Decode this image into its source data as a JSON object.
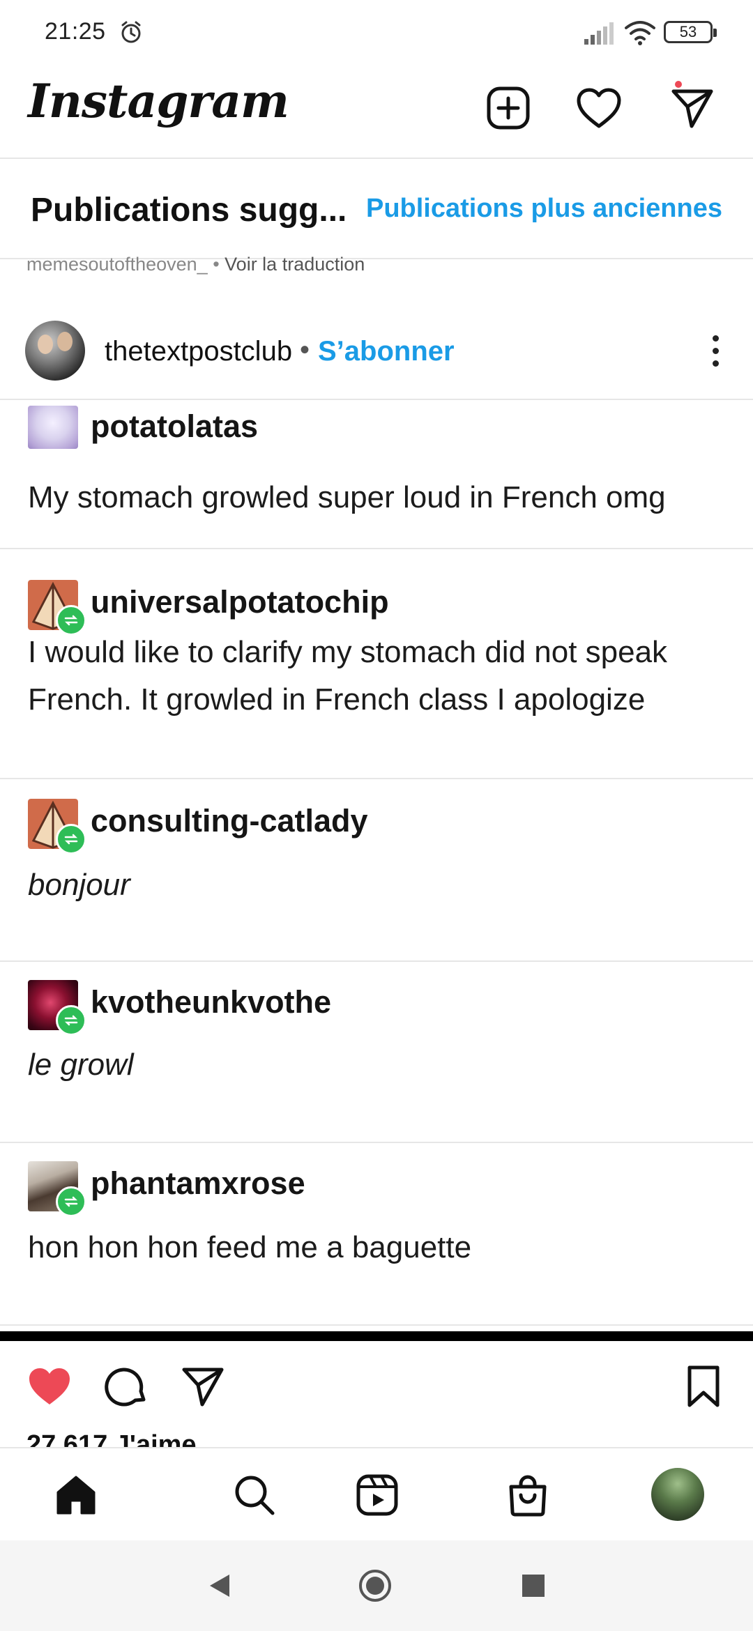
{
  "status_bar": {
    "time": "21:25",
    "battery": "53"
  },
  "header": {
    "logo": "Instagram"
  },
  "tabs": {
    "suggested": "Publications sugg...",
    "older": "Publications plus anciennes"
  },
  "previous_post": {
    "caption_user": "memesoutoftheoven_",
    "separator": "•",
    "translate": "Voir la traduction"
  },
  "post": {
    "username": "thetextpostclub",
    "separator": "•",
    "follow_label": "S’abonner",
    "thread": [
      {
        "user": "potatolatas",
        "text": "My stomach growled super loud in French omg",
        "reblog": false,
        "italic": false
      },
      {
        "user": "universalpotatochip",
        "text": "I would like to clarify my stomach did not speak French. It growled in French class I apologize",
        "reblog": true,
        "italic": false
      },
      {
        "user": "consulting-catlady",
        "text": "bonjour",
        "reblog": true,
        "italic": true
      },
      {
        "user": "kvotheunkvothe",
        "text": "le growl",
        "reblog": true,
        "italic": true
      },
      {
        "user": "phantamxrose",
        "text": "hon hon hon feed me a baguette",
        "reblog": true,
        "italic": false
      }
    ],
    "likes": "27 617 J'aime"
  },
  "colors": {
    "accent": "#1a9be6",
    "like": "#ed4956",
    "reblog": "#2ebd57"
  },
  "icons": {
    "alarm": "alarm-icon",
    "signal": "signal-icon",
    "wifi": "wifi-icon",
    "new_post": "plus-square-icon",
    "activity": "heart-icon",
    "direct": "send-icon",
    "like": "heart-filled-icon",
    "comment": "comment-icon",
    "share": "send-icon",
    "save": "bookmark-icon",
    "home": "home-icon",
    "search": "search-icon",
    "reels": "reels-icon",
    "shop": "shop-icon"
  }
}
